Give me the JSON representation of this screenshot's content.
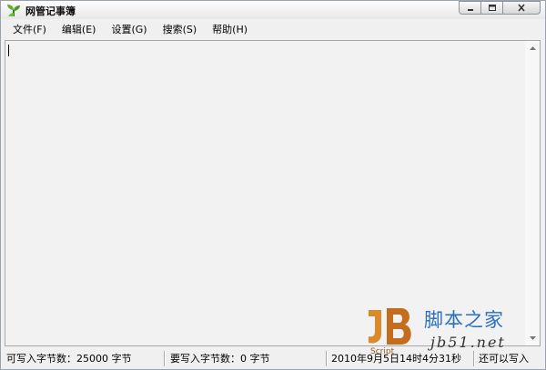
{
  "window": {
    "title": "网管记事簿",
    "controls": [
      "minimize-icon",
      "maximize-icon",
      "close-icon"
    ]
  },
  "menu": {
    "items": [
      {
        "label": "文件(F)",
        "name": "file"
      },
      {
        "label": "编辑(E)",
        "name": "edit"
      },
      {
        "label": "设置(G)",
        "name": "settings"
      },
      {
        "label": "搜索(S)",
        "name": "search"
      },
      {
        "label": "帮助(H)",
        "name": "help"
      }
    ]
  },
  "editor": {
    "text": ""
  },
  "status": {
    "writable_bytes": "可写入字节数：25000 字节",
    "to_write_bytes": "要写入字节数：0 字节",
    "datetime": "2010年9月5日14时4分31秒",
    "remaining": "还可以写入"
  },
  "watermark": {
    "logo_letters": "JB",
    "site_name": "脚本之家",
    "url": "jb51.net",
    "caption": "Script"
  },
  "colors": {
    "editor_bg": "#f2f2f2",
    "watermark_blue": "#2b6fbf",
    "watermark_orange": "#d98a2b"
  }
}
